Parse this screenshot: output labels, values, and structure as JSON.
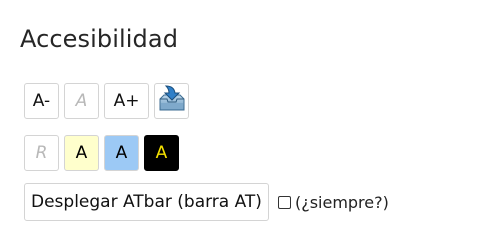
{
  "section": {
    "title": "Accesibilidad"
  },
  "font_size_row": {
    "decrease_label": "A-",
    "reset_label": "A",
    "increase_label": "A+"
  },
  "color_row": {
    "reset_label": "R",
    "yellow_label": "A",
    "blue_label": "A",
    "black_label": "A"
  },
  "atbar": {
    "deploy_label": "Desplegar ATbar (barra AT)",
    "always_label": "(¿siempre?)",
    "always_checked": false
  },
  "colors": {
    "yellow_bg": "#ffffcc",
    "blue_bg": "#9cc9f5",
    "black_bg": "#000000",
    "black_fg": "#f4e000"
  },
  "icons": {
    "save_icon": "download-tray-icon"
  }
}
